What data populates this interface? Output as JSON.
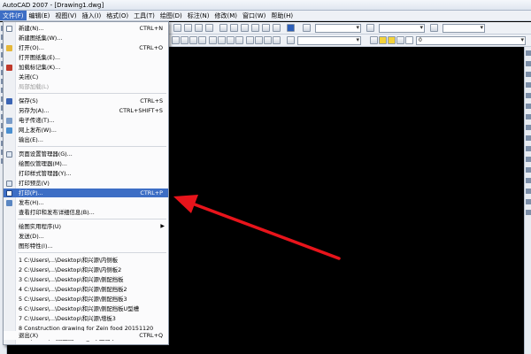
{
  "window": {
    "title": "AutoCAD 2007 - [Drawing1.dwg]"
  },
  "menubar": {
    "items": [
      "文件(F)",
      "编辑(E)",
      "视图(V)",
      "插入(I)",
      "格式(O)",
      "工具(T)",
      "绘图(D)",
      "标注(N)",
      "修改(M)",
      "窗口(W)",
      "帮助(H)"
    ]
  },
  "toolbar": {
    "layer_value": "0"
  },
  "file_menu": {
    "new": {
      "label": "新建(N)...",
      "shortcut": "CTRL+N"
    },
    "new_sheetset": {
      "label": "新建图纸集(W)..."
    },
    "open": {
      "label": "打开(O)...",
      "shortcut": "CTRL+O"
    },
    "open_sheetset": {
      "label": "打开图纸集(E)..."
    },
    "load_markup": {
      "label": "加载标记集(K)..."
    },
    "close": {
      "label": "关闭(C)"
    },
    "partial_load": {
      "label": "局部加载(L)"
    },
    "save": {
      "label": "保存(S)",
      "shortcut": "CTRL+S"
    },
    "save_as": {
      "label": "另存为(A)...",
      "shortcut": "CTRL+SHIFT+S"
    },
    "etransmit": {
      "label": "电子传递(T)..."
    },
    "web_publish": {
      "label": "网上发布(W)..."
    },
    "export": {
      "label": "输出(E)..."
    },
    "page_setup": {
      "label": "页面设置管理器(G)..."
    },
    "plotter_manager": {
      "label": "绘图仪管理器(M)..."
    },
    "plot_style_manager": {
      "label": "打印样式管理器(Y)..."
    },
    "plot_preview": {
      "label": "打印预览(V)"
    },
    "plot": {
      "label": "打印(P)...",
      "shortcut": "CTRL+P"
    },
    "publish": {
      "label": "发布(H)..."
    },
    "plot_details": {
      "label": "查看打印和发布详细信息(B)..."
    },
    "drawing_utilities": {
      "label": "绘图实用程序(U)"
    },
    "send": {
      "label": "发送(D)..."
    },
    "drawing_properties": {
      "label": "图形特性(I)..."
    },
    "recent": [
      "1 C:\\Users\\...\\Desktop\\和兴源\\内侧板",
      "2 C:\\Users\\...\\Desktop\\和兴源\\内侧板2",
      "3 C:\\Users\\...\\Desktop\\和兴源\\侧配挡板",
      "4 C:\\Users\\...\\Desktop\\和兴源\\侧配挡板2",
      "5 C:\\Users\\...\\Desktop\\和兴源\\侧配挡板3",
      "6 C:\\Users\\...\\Desktop\\和兴源\\侧配挡板U型槽",
      "7 C:\\Users\\...\\Desktop\\和兴源\\增板3",
      "8 Construction drawing for Zein food 20151120",
      "9 C:\\Users\\...\\施工图5.20_t3( 王嘉 )"
    ],
    "exit": {
      "label": "退出(X)",
      "shortcut": "CTRL+Q"
    }
  },
  "colors": {
    "highlight": "#3d6ec5",
    "arrow": "#e8141b",
    "canvas": "#000000"
  }
}
